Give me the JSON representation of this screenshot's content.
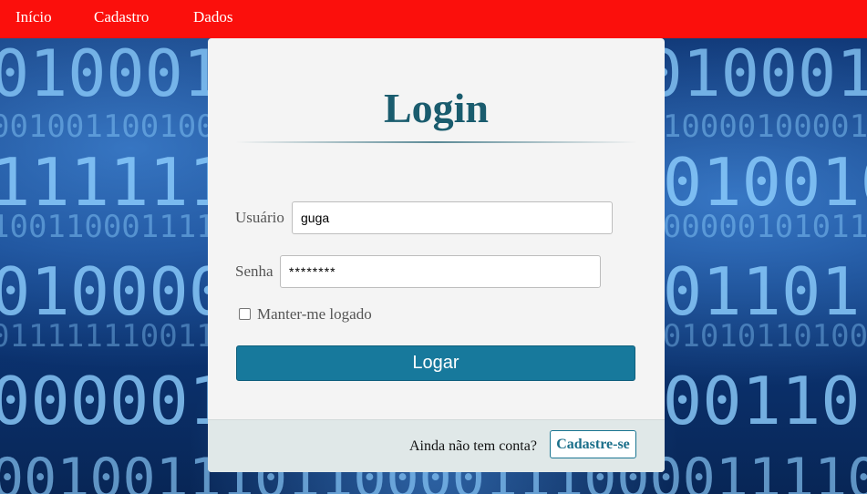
{
  "nav": {
    "items": [
      {
        "label": "Início"
      },
      {
        "label": "Cadastro"
      },
      {
        "label": "Dados"
      }
    ]
  },
  "login": {
    "title": "Login",
    "username_label": "Usuário",
    "username_value": "guga",
    "password_label": "Senha",
    "password_value": "********",
    "remember_label": "Manter-me logado",
    "remember_checked": false,
    "submit_label": "Logar"
  },
  "footer": {
    "prompt": "Ainda não tem conta?",
    "signup_label": "Cadastre-se"
  },
  "colors": {
    "nav_bg": "#fb0f0c",
    "title": "#1a5c6e",
    "button": "#17799c",
    "card": "#f4f4f4",
    "footer": "#e0e8e8"
  }
}
